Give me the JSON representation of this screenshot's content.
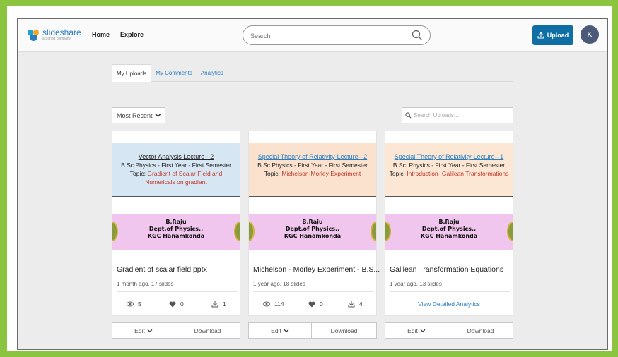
{
  "brand": {
    "name": "slideshare",
    "tagline": "a Scribd company"
  },
  "nav": {
    "home": "Home",
    "explore": "Explore"
  },
  "search": {
    "placeholder": "Search"
  },
  "upload_button": "Upload",
  "avatar_letter": "K",
  "tabs": [
    {
      "label": "My Uploads",
      "active": true
    },
    {
      "label": "My Comments",
      "active": false
    },
    {
      "label": "Analytics",
      "active": false
    }
  ],
  "sort": {
    "selected": "Most Recent"
  },
  "uploads_search": {
    "placeholder": "Search Uploads..."
  },
  "cards": [
    {
      "thumb": {
        "title": "Vector Analysis Lecture - 2",
        "subtitle": "B.Sc Physics - First Year - First Semester",
        "topic_key": "Topic:",
        "topic_value_1": "Gradient of Scalar Field and",
        "topic_value_2": "Numericals on gradient",
        "author": "B.Raju",
        "dept": "Dept.of Physics.,",
        "college": "KGC Hanamkonda",
        "band_color": "#d7e6f3",
        "title_color": "#222222"
      },
      "title": "Gradient of scalar field.pptx",
      "meta": "1 month ago, 17 slides",
      "views": "5",
      "likes": "0",
      "downloads": "1",
      "edit_label": "Edit",
      "download_label": "Download"
    },
    {
      "thumb": {
        "title": "Special Theory of Relativity-Lecture– 2",
        "subtitle": "B.Sc Physics - First Year - First Semester",
        "topic_key": "Topic:",
        "topic_value_1": "Michelson-Morley Experiment",
        "topic_value_2": "",
        "author": "B.Raju",
        "dept": "Dept.of Physics.,",
        "college": "KGC Hanamkonda",
        "band_color": "#fbe2cf",
        "title_color": "#2a7ec2"
      },
      "title": "Michelson - Morley Experiment - B.S...",
      "meta": "1 year ago, 18 slides",
      "views": "114",
      "likes": "0",
      "downloads": "4",
      "edit_label": "Edit",
      "download_label": "Download"
    },
    {
      "thumb": {
        "title": "Special Theory of Relativity-Lecture– 1",
        "subtitle": "B.Sc. Physics - First Year - First Semester",
        "topic_key": "Topic:",
        "topic_value_1": "Introduction- Galilean Transformations",
        "topic_value_2": "",
        "author": "B.Raju",
        "dept": "Dept.of Physics.,",
        "college": "KGC Hanamkonda",
        "band_color": "#fce6d4",
        "title_color": "#2a7ec2"
      },
      "title": "Galilean Transformation Equations",
      "meta": "1 year ago, 13 slides",
      "analytics_link": "View Detailed Analytics",
      "edit_label": "Edit",
      "download_label": "Download"
    }
  ],
  "colors": {
    "accent": "#0f6fa5",
    "frame_green": "#8bc53f",
    "link_blue": "#2a7ec2",
    "thumb_pink": "#f1c6ee"
  }
}
